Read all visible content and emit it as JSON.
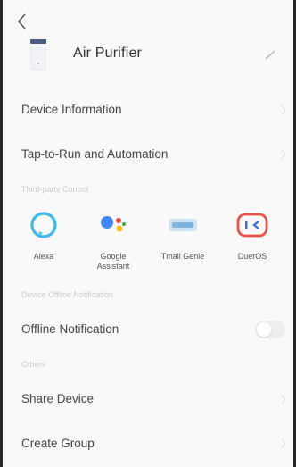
{
  "device": {
    "name": "Air Purifier"
  },
  "menu": {
    "device_information": "Device Information",
    "tap_to_run": "Tap-to-Run and Automation"
  },
  "sections": {
    "third_party": "Third-party Control",
    "offline": "Device Offline Notification",
    "others": "Others"
  },
  "third_party_items": [
    {
      "label": "Alexa",
      "icon": "alexa-icon"
    },
    {
      "label": "Google\nAssistant",
      "icon": "google-assistant-icon"
    },
    {
      "label": "Tmall Genie",
      "icon": "tmall-genie-icon"
    },
    {
      "label": "DuerOS",
      "icon": "dueros-icon"
    }
  ],
  "offline": {
    "label": "Offline Notification",
    "enabled": false
  },
  "others": {
    "share_device": "Share Device",
    "create_group": "Create Group"
  },
  "colors": {
    "alexa": "#3fb8e8",
    "google_blue": "#4285f4",
    "google_red": "#ea4335",
    "google_yellow": "#fbbc05",
    "google_green": "#34a853",
    "tmall": "#7fb4dc",
    "dueros_red": "#e8544a",
    "dueros_blue": "#3f6fd6"
  }
}
